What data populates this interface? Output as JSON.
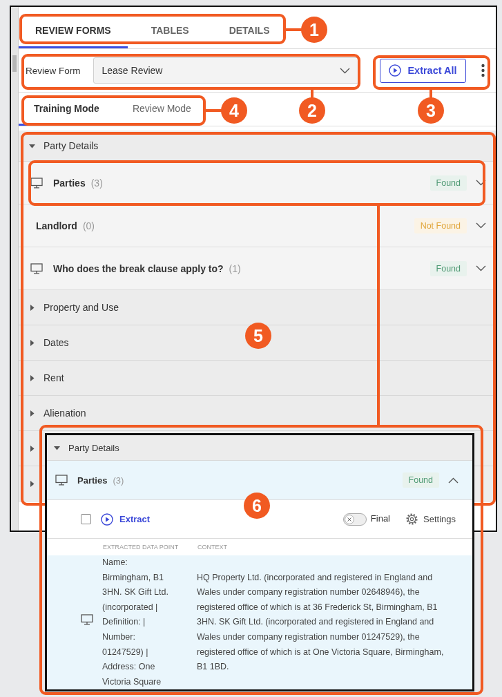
{
  "tabs": [
    {
      "label": "REVIEW FORMS",
      "selected": true
    },
    {
      "label": "TABLES",
      "selected": false
    },
    {
      "label": "DETAILS",
      "selected": false
    }
  ],
  "review_form": {
    "label": "Review Form",
    "value": "Lease Review"
  },
  "extract_all_button": "Extract All",
  "modes": [
    {
      "label": "Training Mode",
      "selected": true
    },
    {
      "label": "Review Mode",
      "selected": false
    }
  ],
  "tree": [
    {
      "label": "Party Details",
      "expanded": true,
      "children": [
        {
          "title": "Parties",
          "count": "(3)",
          "has_icon": true,
          "color": "#4f9a74",
          "status_label": "Found",
          "expanded": false
        },
        {
          "title": "Landlord",
          "count": "(0)",
          "has_icon": false,
          "color": "#e0a53a",
          "status_label": "Not Found",
          "expanded": false
        },
        {
          "title": "Who does the break clause apply to?",
          "count": "(1)",
          "has_icon": true,
          "color": "#4f9a74",
          "status_label": "Found",
          "expanded": false
        }
      ]
    },
    {
      "label": "Property and Use",
      "expanded": false
    },
    {
      "label": "Dates",
      "expanded": false
    },
    {
      "label": "Rent",
      "expanded": false
    },
    {
      "label": "Alienation",
      "expanded": false
    },
    {
      "expanded": false
    },
    {
      "expanded": false
    }
  ],
  "detail_inset": {
    "section": {
      "label": "Party Details",
      "expanded": true
    },
    "item": {
      "title": "Parties",
      "count": "(3)",
      "has_icon": true,
      "color": "#4f9a74",
      "status_label": "Found",
      "expanded": true
    },
    "select_checked": false,
    "extract_button": "Extract",
    "final_toggle": {
      "label": "Final",
      "on": false
    },
    "settings_button": "Settings",
    "columns": [
      "EXTRACTED DATA POINT",
      "CONTEXT"
    ],
    "rows": [
      {
        "has_icon": true,
        "data_point": "Name: Birmingham, B1 3HN. SK Gift Ltd. (incorporated | Definition: | Number: 01247529) | Address: One Victoria Square",
        "context": "HQ Property Ltd. (incorporated and registered in England and Wales under company registration number 02648946), the registered office of which is at 36 Frederick St, Birmingham, B1 3HN. SK Gift Ltd. (incorporated and registered in England and Wales under company registration number 01247529), the registered office of which is at One Victoria Square, Birmingham, B1 1BD."
      }
    ]
  },
  "callouts": [
    {
      "number": "1"
    },
    {
      "number": "4"
    },
    {
      "number": "2"
    },
    {
      "number": "3"
    },
    {
      "number": "5"
    },
    {
      "number": "6"
    }
  ]
}
